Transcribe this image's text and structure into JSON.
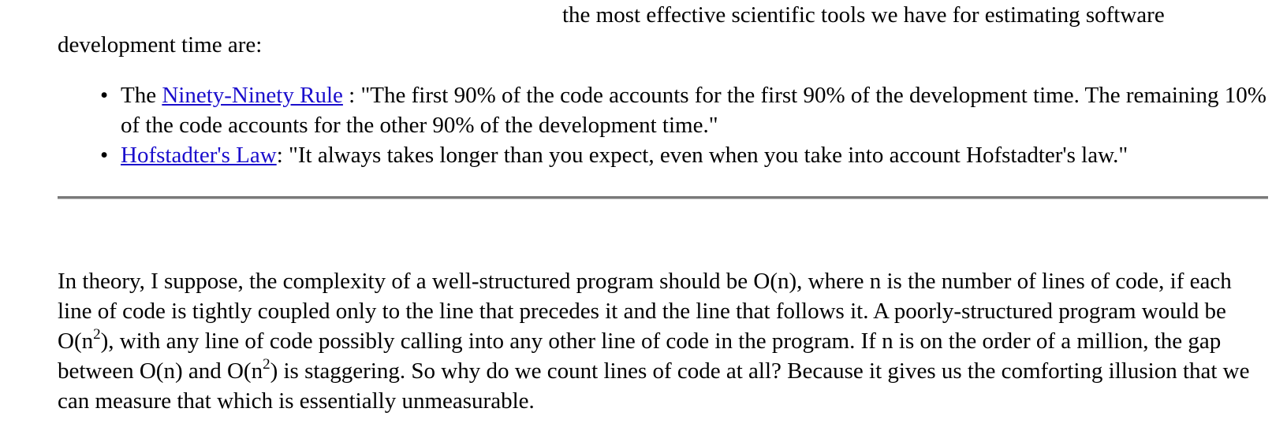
{
  "intro": {
    "line1": "the most effective scientific tools we have for estimating software",
    "line2": " development time are:"
  },
  "rules": [
    {
      "bullet": "•",
      "prefix": "The ",
      "link_text": "Ninety-Ninety Rule",
      "separator": " :  ",
      "quote": "\"The first 90% of the code accounts for the first 90% of the development time. The remaining 10% of the code accounts for the other 90% of the development time.\""
    },
    {
      "bullet": "•",
      "prefix": "",
      "link_text": "Hofstadter's Law",
      "separator": ":  ",
      "quote": "\"It always takes longer than you expect, even when you take into account Hofstadter's law.\""
    }
  ],
  "theory": {
    "part1": "In theory, I suppose, the complexity of a well-structured program should be O(n), where n is the number of lines of code, if each line of code is tightly coupled only to the line that precedes it and the line that follows it.  A poorly-structured program would be O(n",
    "sup1": "2",
    "part2": "), with any line of code possibly calling into any other line of code in the program.  If n is on the order of a million, the gap between O(n) and O(n",
    "sup2": "2",
    "part3": ") is staggering.  So why do we count lines of code at all?  Because it gives us the comforting illusion that we can measure that which is essentially unmeasurable."
  },
  "colors": {
    "link": "#1a0dcc",
    "text": "#000000",
    "divider": "#7a7a7a"
  }
}
